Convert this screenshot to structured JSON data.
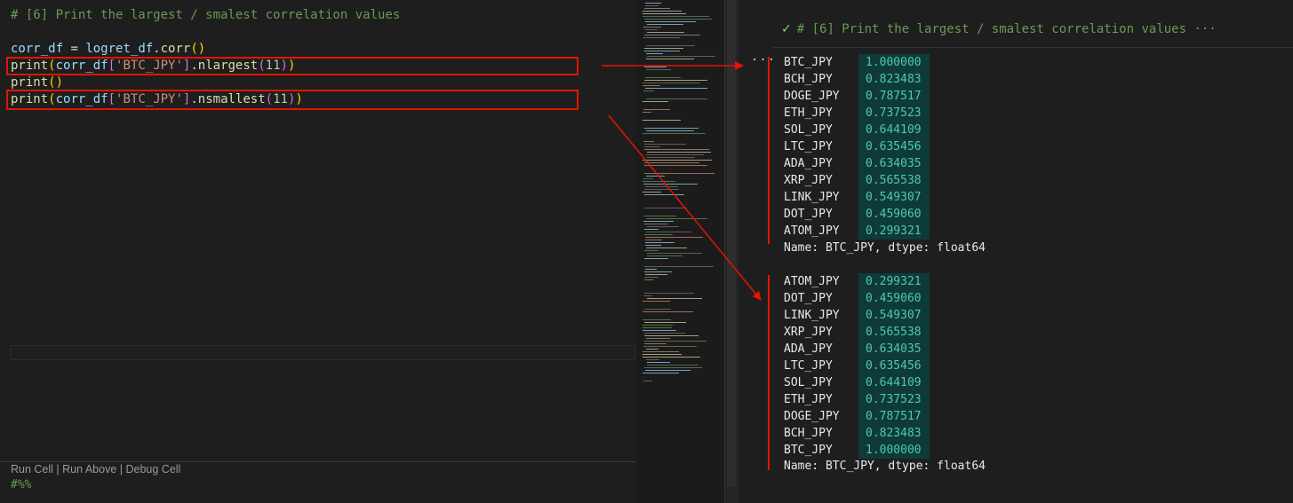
{
  "editor": {
    "comment": "# [6] Print the largest / smalest correlation values",
    "line2": {
      "var": "corr_df",
      "op": " = ",
      "obj": "logret_df",
      "dot": ".",
      "fn": "corr",
      "open": "(",
      "close": ")"
    },
    "line3": {
      "fn": "print",
      "var": "corr_df",
      "key": "'BTC_JPY'",
      "method": "nlargest",
      "num": "11"
    },
    "line4": {
      "fn": "print",
      "parens": "()"
    },
    "line5": {
      "fn": "print",
      "var": "corr_df",
      "key": "'BTC_JPY'",
      "method": "nsmallest",
      "num": "11"
    },
    "codelens": "Run Cell | Run Above | Debug Cell",
    "cell_marker": "#%%"
  },
  "output": {
    "header": "# [6] Print the largest / smalest correlation values",
    "header_ellipsis": "···",
    "more": "···",
    "largest": [
      {
        "name": "BTC_JPY",
        "value": "1.000000"
      },
      {
        "name": "BCH_JPY",
        "value": "0.823483"
      },
      {
        "name": "DOGE_JPY",
        "value": "0.787517"
      },
      {
        "name": "ETH_JPY",
        "value": "0.737523"
      },
      {
        "name": "SOL_JPY",
        "value": "0.644109"
      },
      {
        "name": "LTC_JPY",
        "value": "0.635456"
      },
      {
        "name": "ADA_JPY",
        "value": "0.634035"
      },
      {
        "name": "XRP_JPY",
        "value": "0.565538"
      },
      {
        "name": "LINK_JPY",
        "value": "0.549307"
      },
      {
        "name": "DOT_JPY",
        "value": "0.459060"
      },
      {
        "name": "ATOM_JPY",
        "value": "0.299321"
      }
    ],
    "largest_footer": "Name: BTC_JPY, dtype: float64",
    "smallest": [
      {
        "name": "ATOM_JPY",
        "value": "0.299321"
      },
      {
        "name": "DOT_JPY",
        "value": "0.459060"
      },
      {
        "name": "LINK_JPY",
        "value": "0.549307"
      },
      {
        "name": "XRP_JPY",
        "value": "0.565538"
      },
      {
        "name": "ADA_JPY",
        "value": "0.634035"
      },
      {
        "name": "LTC_JPY",
        "value": "0.635456"
      },
      {
        "name": "SOL_JPY",
        "value": "0.644109"
      },
      {
        "name": "ETH_JPY",
        "value": "0.737523"
      },
      {
        "name": "DOGE_JPY",
        "value": "0.787517"
      },
      {
        "name": "BCH_JPY",
        "value": "0.823483"
      },
      {
        "name": "BTC_JPY",
        "value": "1.000000"
      }
    ],
    "smallest_footer": "Name: BTC_JPY, dtype: float64"
  },
  "colors": {
    "highlight": "#e51400",
    "value_bg": "#0f3a3a",
    "value_fg": "#4ec9b0",
    "comment": "#6a9955"
  },
  "icons": {
    "run_status": "check-icon",
    "more": "ellipsis-icon"
  }
}
